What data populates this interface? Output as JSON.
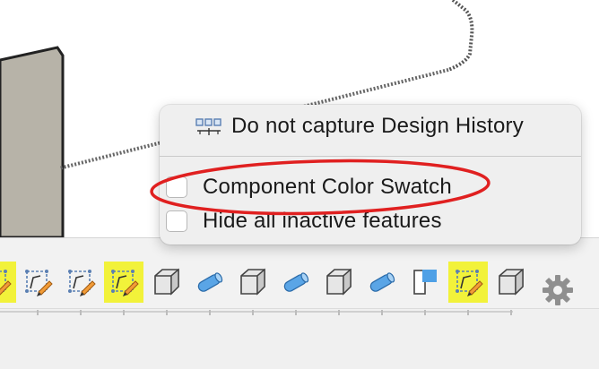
{
  "viewport": {
    "background": "#ffffff",
    "model_face_color": "#b7b3a8",
    "model_edge_color": "#222222"
  },
  "context_menu": {
    "items": [
      {
        "label": "Do not capture Design History",
        "icon": "design-history-icon",
        "type": "action"
      },
      {
        "label": "Component Color Swatch",
        "type": "checkbox",
        "checked": false
      },
      {
        "label": "Hide all inactive features",
        "type": "checkbox",
        "checked": false
      }
    ],
    "highlight_color": "#e02020"
  },
  "timeline": {
    "active_color": "#f2f23a",
    "features": [
      {
        "icon": "sketch-icon",
        "active": true
      },
      {
        "icon": "sketch-icon",
        "active": false
      },
      {
        "icon": "sketch-icon",
        "active": false
      },
      {
        "icon": "sketch-icon",
        "active": true
      },
      {
        "icon": "body-icon",
        "active": false
      },
      {
        "icon": "pipe-icon",
        "active": false
      },
      {
        "icon": "body-icon",
        "active": false
      },
      {
        "icon": "pipe-icon",
        "active": false
      },
      {
        "icon": "body-icon",
        "active": false
      },
      {
        "icon": "pipe-icon",
        "active": false
      },
      {
        "icon": "plane-icon",
        "active": false
      },
      {
        "icon": "sketch-icon",
        "active": true
      },
      {
        "icon": "body-icon",
        "active": false
      }
    ],
    "settings_icon": "gear-icon"
  }
}
